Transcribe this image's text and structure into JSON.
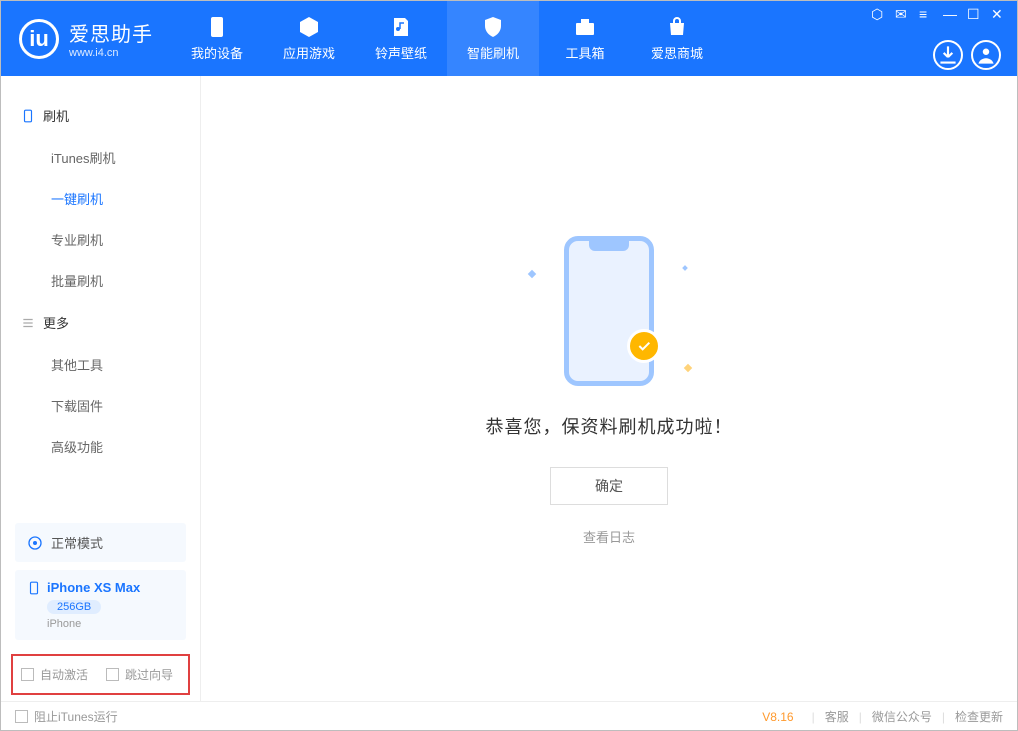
{
  "app": {
    "name": "爱思助手",
    "url": "www.i4.cn"
  },
  "tabs": {
    "device": "我的设备",
    "apps": "应用游戏",
    "ring": "铃声壁纸",
    "flash": "智能刷机",
    "tools": "工具箱",
    "store": "爱思商城"
  },
  "sidebar": {
    "sec1": "刷机",
    "items1": {
      "itunes": "iTunes刷机",
      "oneclick": "一键刷机",
      "pro": "专业刷机",
      "batch": "批量刷机"
    },
    "sec2": "更多",
    "items2": {
      "other": "其他工具",
      "firmware": "下载固件",
      "advanced": "高级功能"
    },
    "mode": "正常模式",
    "device": {
      "name": "iPhone XS Max",
      "storage": "256GB",
      "type": "iPhone"
    },
    "checks": {
      "auto_activate": "自动激活",
      "skip_guide": "跳过向导"
    }
  },
  "main": {
    "success": "恭喜您，保资料刷机成功啦！",
    "ok": "确定",
    "log": "查看日志"
  },
  "footer": {
    "block_itunes": "阻止iTunes运行",
    "version": "V8.16",
    "support": "客服",
    "wechat": "微信公众号",
    "update": "检查更新"
  }
}
